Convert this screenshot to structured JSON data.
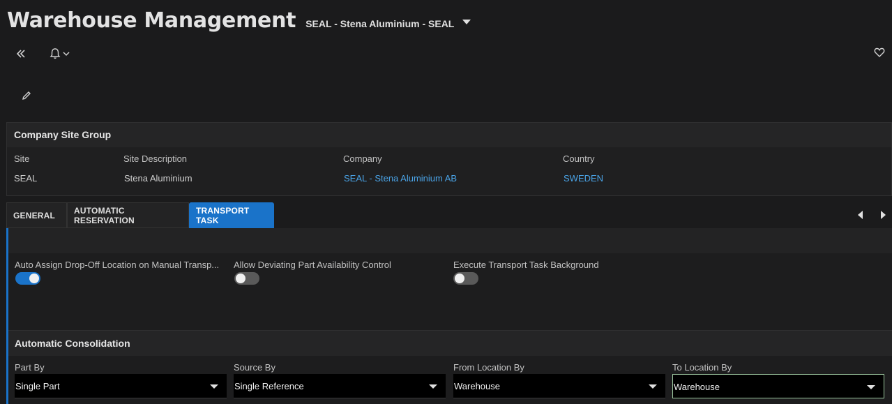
{
  "header": {
    "title": "Warehouse Management",
    "context": "SEAL - Stena Aluminium - SEAL"
  },
  "icons": {
    "back": "double-chevron-left-icon",
    "notifications": "bell-icon",
    "favorite": "heart-icon",
    "edit": "pencil-icon"
  },
  "site_group": {
    "title": "Company Site Group",
    "fields": [
      {
        "label": "Site",
        "value": "SEAL"
      },
      {
        "label": "Site Description",
        "value": "Stena Aluminium"
      },
      {
        "label": "Company",
        "value": "SEAL - Stena Aluminium AB"
      },
      {
        "label": "Country",
        "value": "SWEDEN"
      }
    ]
  },
  "tabs": [
    {
      "label": "GENERAL"
    },
    {
      "label": "AUTOMATIC RESERVATION"
    },
    {
      "label": "TRANSPORT TASK",
      "active": true
    }
  ],
  "toggles": [
    {
      "label": "Auto Assign Drop-Off Location on Manual Transp...",
      "on": true
    },
    {
      "label": "Allow Deviating Part Availability Control",
      "on": false
    },
    {
      "label": "Execute Transport Task Background",
      "on": false
    }
  ],
  "consolidation": {
    "title": "Automatic Consolidation",
    "fields": [
      {
        "label": "Part By",
        "value": "Single Part"
      },
      {
        "label": "Source By",
        "value": "Single Reference"
      },
      {
        "label": "From Location By",
        "value": "Warehouse"
      },
      {
        "label": "To Location By",
        "value": "Warehouse"
      }
    ]
  },
  "colors": {
    "accent": "#1a73c9",
    "link": "#4aa3e6",
    "background": "#1b1b1c"
  }
}
